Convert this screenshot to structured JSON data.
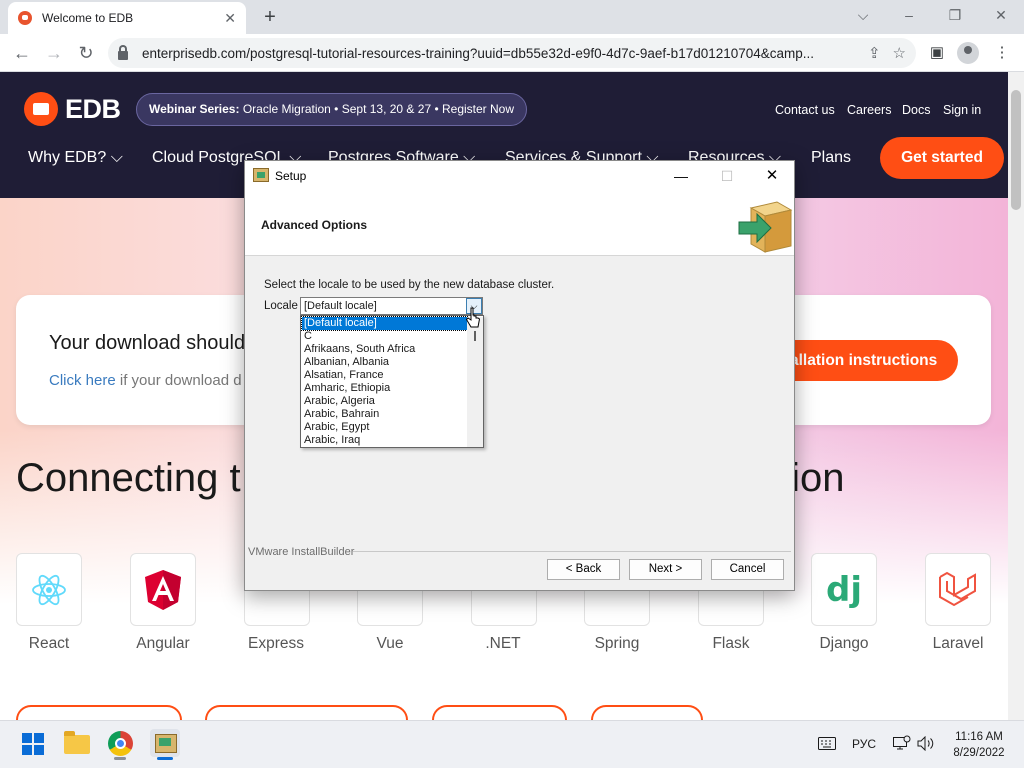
{
  "browser": {
    "tab_title": "Welcome to EDB",
    "tab_close": "✕",
    "new_tab": "+",
    "url": "enterprisedb.com/postgresql-tutorial-resources-training?uuid=db55e32d-e9f0-4d7c-9aef-b17d01210704&camp...",
    "window_controls": {
      "dropdown": "⌵",
      "minimize": "–",
      "restore": "❐",
      "close": "✕"
    },
    "nav": {
      "back": "←",
      "forward": "→",
      "reload": "↻"
    },
    "toolbar_icons": {
      "share": "⇪",
      "bookmark": "☆",
      "sidepanel": "▣",
      "menu": "⋮"
    }
  },
  "edb": {
    "logo_text": "EDB",
    "webinar": {
      "bold": "Webinar Series:",
      "text": " Oracle Migration • Sept 13, 20 & 27 • Register Now"
    },
    "top_links": [
      "Contact us",
      "Careers",
      "Docs",
      "Sign in"
    ],
    "nav_items": [
      "Why EDB? ⌵",
      "Cloud PostgreSQL ⌵",
      "Postgres Software ⌵",
      "Services & Support ⌵",
      "Resources ⌵",
      "Plans"
    ],
    "get_started": "Get started",
    "download_title": "Your download should",
    "download_sub_link": "Click here",
    "download_sub_text": " if your download d",
    "install_btn": "allation instructions",
    "connecting_left": "Connecting t",
    "connecting_right": "tion",
    "frameworks": [
      "React",
      "Angular",
      "Express",
      "Vue",
      ".NET",
      "Spring",
      "Flask",
      "Django",
      "Laravel"
    ]
  },
  "dialog": {
    "title": "Setup",
    "controls": {
      "minimize": "—",
      "maximize": "☐",
      "close": "✕"
    },
    "header": "Advanced Options",
    "prompt": "Select the locale to be used by the new database cluster.",
    "locale_label": "Locale",
    "locale_value": "[Default locale]",
    "locale_options": [
      "[Default locale]",
      "C",
      "Afrikaans, South Africa",
      "Albanian, Albania",
      "Alsatian, France",
      "Amharic, Ethiopia",
      "Arabic, Algeria",
      "Arabic, Bahrain",
      "Arabic, Egypt",
      "Arabic, Iraq"
    ],
    "selected_option": "[Default locale]",
    "brand": "VMware InstallBuilder",
    "buttons": {
      "back": "< Back",
      "next": "Next >",
      "cancel": "Cancel"
    }
  },
  "taskbar": {
    "lang": "РУС",
    "time": "11:16 AM",
    "date": "8/29/2022"
  }
}
